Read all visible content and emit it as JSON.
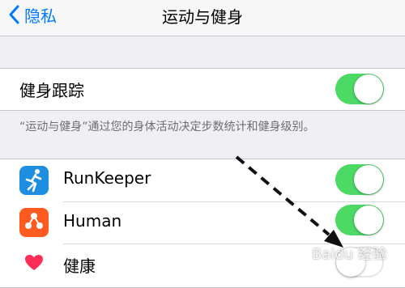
{
  "nav": {
    "back_label": "隐私",
    "title": "运动与健身"
  },
  "fitness": {
    "label": "健身跟踪",
    "enabled": true,
    "footnote": "“运动与健身”通过您的身体活动决定步数统计和健身级别。"
  },
  "apps": [
    {
      "name": "RunKeeper",
      "icon": "runner-icon",
      "enabled": true
    },
    {
      "name": "Human",
      "icon": "human-dots-icon",
      "enabled": true
    },
    {
      "name": "健康",
      "icon": "heart-icon",
      "enabled": false
    }
  ],
  "colors": {
    "accent": "#007aff",
    "toggle_on": "#4cd964",
    "runkeeper": "#1e8ee0",
    "human": "#ff5a1f",
    "health_heart": "#ff2d55"
  },
  "watermark": {
    "text": "Baidu 经验"
  }
}
